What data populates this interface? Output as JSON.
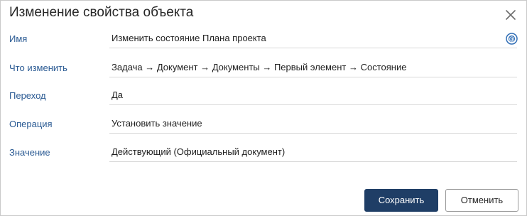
{
  "dialog": {
    "title": "Изменение свойства объекта"
  },
  "fields": [
    {
      "label": "Имя",
      "value": "Изменить состояние Плана проекта"
    },
    {
      "label": "Что изменить",
      "value": "Задача → Документ → Документы → Первый элемент → Состояние"
    },
    {
      "label": "Переход",
      "value": "Да"
    },
    {
      "label": "Операция",
      "value": "Установить значение"
    },
    {
      "label": "Значение",
      "value": "Действующий (Официальный документ)"
    }
  ],
  "buttons": {
    "save": "Сохранить",
    "cancel": "Отменить"
  },
  "icons": {
    "close": "close-icon",
    "name_field_action": "at-sign-icon"
  },
  "colors": {
    "label": "#2a5a93",
    "primary_button": "#1f3e66",
    "icon_blue": "#2f6db5"
  }
}
